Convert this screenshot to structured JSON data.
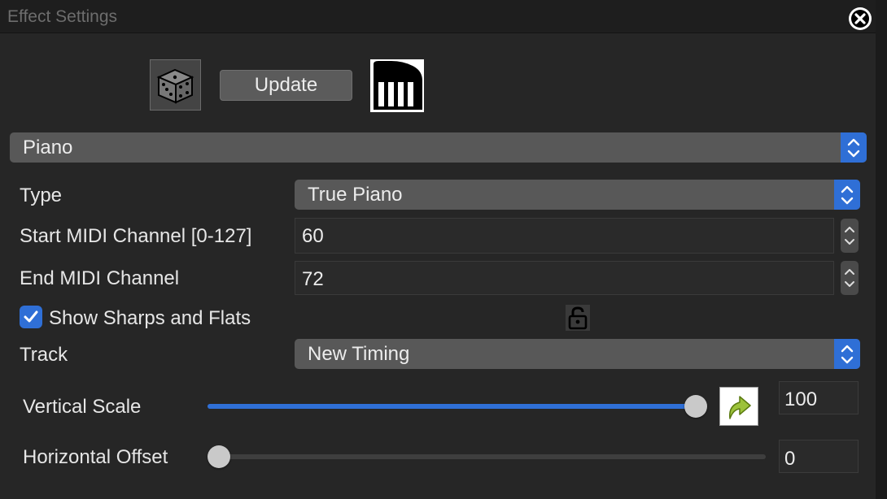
{
  "window": {
    "title": "Effect Settings"
  },
  "toolbar": {
    "update_label": "Update"
  },
  "effect_select": {
    "value": "Piano"
  },
  "type_row": {
    "label": "Type",
    "value": "True Piano"
  },
  "start_row": {
    "label": "Start MIDI Channel [0-127]",
    "value": "60"
  },
  "end_row": {
    "label": "End MIDI Channel",
    "value": "72"
  },
  "sharps": {
    "label": "Show Sharps and Flats",
    "checked": true
  },
  "track_row": {
    "label": "Track",
    "value": "New Timing"
  },
  "vertical_scale": {
    "label": "Vertical Scale",
    "value": "100",
    "min": 0,
    "max": 100
  },
  "horizontal_offset": {
    "label": "Horizontal Offset",
    "value": "0",
    "min": 0,
    "max": 100
  },
  "colors": {
    "accent": "#2f6fd6",
    "background": "#262626",
    "control": "#585858"
  },
  "icons": [
    "close-icon",
    "dice-icon",
    "piano-icon",
    "lock-icon",
    "reset-arrow-icon",
    "updown-chevron-icon",
    "checkmark-icon"
  ]
}
